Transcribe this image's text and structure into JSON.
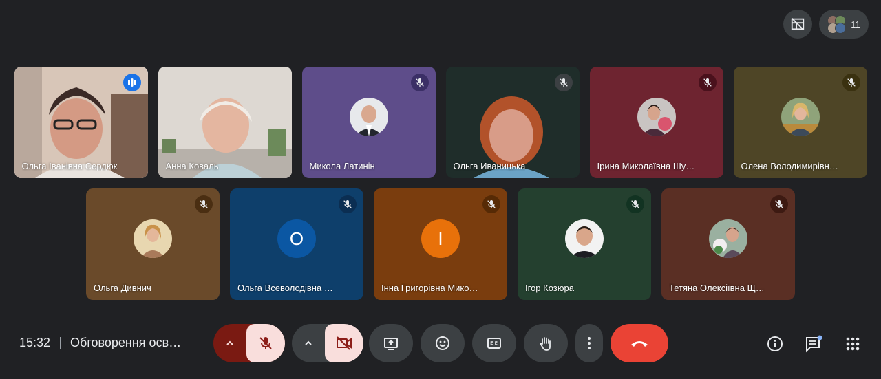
{
  "topbar": {
    "participants_count": "11"
  },
  "tiles_row1": [
    {
      "name": "Ольга Іванівна Сердюк",
      "type": "video",
      "speaking": true
    },
    {
      "name": "Анна Коваль",
      "type": "video",
      "speaking": false
    },
    {
      "name": "Микола Латинін",
      "type": "avatar",
      "bg": "#5e4d8a",
      "mic_bg": "#3b2f66"
    },
    {
      "name": "Ольга Иваницька",
      "type": "video",
      "speaking": false,
      "mic_bg": "#3c4043"
    },
    {
      "name": "Ірина Миколаївна Шу…",
      "type": "avatar",
      "bg": "#6e2430",
      "mic_bg": "#4a111c"
    },
    {
      "name": "Олена Володимирівн…",
      "type": "avatar",
      "bg": "#4e4526",
      "mic_bg": "#3a3110"
    }
  ],
  "tiles_row2": [
    {
      "name": "Ольга Дивнич",
      "type": "avatar",
      "bg": "#6a4a2a",
      "mic_bg": "#4a2e12"
    },
    {
      "name": "Ольга Всеволодівна …",
      "type": "letter",
      "letter": "O",
      "bg": "#0e3f6b",
      "circle": "#0b57a3",
      "mic_bg": "#0b2e52"
    },
    {
      "name": "Інна Григорівна Мико…",
      "type": "letter",
      "letter": "I",
      "bg": "#7a3d0e",
      "circle": "#e8710a",
      "mic_bg": "#562a05"
    },
    {
      "name": "Ігор Козюра",
      "type": "avatar",
      "bg": "#24402f",
      "mic_bg": "#123322"
    },
    {
      "name": "Тетяна Олексіївна Щ…",
      "type": "avatar",
      "bg": "#5a2f24",
      "mic_bg": "#3d1a12"
    }
  ],
  "bottom": {
    "time": "15:32",
    "meeting_title": "Обговорення осв…"
  },
  "colors": {
    "end_call": "#ea4335",
    "muted_bg": "#f9dedc",
    "muted_icon": "#8c1d18",
    "background": "#202124"
  }
}
